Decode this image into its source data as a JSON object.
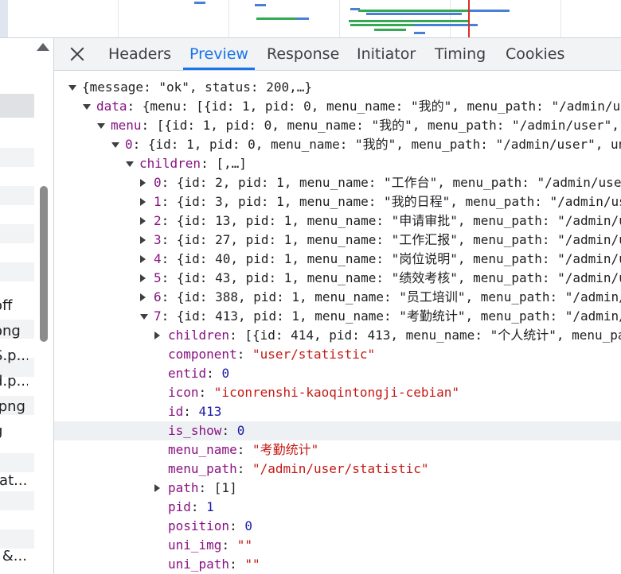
{
  "tabs": [
    {
      "label": "Headers"
    },
    {
      "label": "Preview",
      "active": true
    },
    {
      "label": "Response"
    },
    {
      "label": "Initiator"
    },
    {
      "label": "Timing"
    },
    {
      "label": "Cookies"
    }
  ],
  "left_list": {
    "items": [
      "off",
      "ong",
      "S.p...",
      "d.p...",
      ".png",
      "g",
      "tat...",
      "l &..."
    ]
  },
  "preview": {
    "lines": [
      {
        "indent": 0,
        "toggle": "down",
        "parts": [
          [
            "pl",
            "{message: \"ok\", status: 200,…}"
          ]
        ]
      },
      {
        "indent": 1,
        "toggle": "down",
        "parts": [
          [
            "key",
            "data"
          ],
          [
            "pl",
            ": {menu: [{id: 1, pid: 0, menu_name: \"我的\", menu_path: \"/admin/user\","
          ]
        ]
      },
      {
        "indent": 2,
        "toggle": "down",
        "parts": [
          [
            "key",
            "menu"
          ],
          [
            "pl",
            ": [{id: 1, pid: 0, menu_name: \"我的\", menu_path: \"/admin/user\", uni_"
          ]
        ]
      },
      {
        "indent": 3,
        "toggle": "down",
        "parts": [
          [
            "key",
            "0"
          ],
          [
            "pl",
            ": {id: 1, pid: 0, menu_name: \"我的\", menu_path: \"/admin/user\", uni_pa"
          ]
        ]
      },
      {
        "indent": 4,
        "toggle": "down",
        "parts": [
          [
            "key",
            "children"
          ],
          [
            "pl",
            ": [,…]"
          ]
        ]
      },
      {
        "indent": 5,
        "toggle": "right",
        "parts": [
          [
            "key",
            "0"
          ],
          [
            "pl",
            ": {id: 2, pid: 1, menu_name: \"工作台\", menu_path: \"/admin/user/wo"
          ]
        ]
      },
      {
        "indent": 5,
        "toggle": "right",
        "parts": [
          [
            "key",
            "1"
          ],
          [
            "pl",
            ": {id: 3, pid: 1, menu_name: \"我的日程\", menu_path: \"/admin/user/"
          ]
        ]
      },
      {
        "indent": 5,
        "toggle": "right",
        "parts": [
          [
            "key",
            "2"
          ],
          [
            "pl",
            ": {id: 13, pid: 1, menu_name: \"申请审批\", menu_path: \"/admin/user"
          ]
        ]
      },
      {
        "indent": 5,
        "toggle": "right",
        "parts": [
          [
            "key",
            "3"
          ],
          [
            "pl",
            ": {id: 27, pid: 1, menu_name: \"工作汇报\", menu_path: \"/admin/user"
          ]
        ]
      },
      {
        "indent": 5,
        "toggle": "right",
        "parts": [
          [
            "key",
            "4"
          ],
          [
            "pl",
            ": {id: 40, pid: 1, menu_name: \"岗位说明\", menu_path: \"/admin/user"
          ]
        ]
      },
      {
        "indent": 5,
        "toggle": "right",
        "parts": [
          [
            "key",
            "5"
          ],
          [
            "pl",
            ": {id: 43, pid: 1, menu_name: \"绩效考核\", menu_path: \"/admin/user"
          ]
        ]
      },
      {
        "indent": 5,
        "toggle": "right",
        "parts": [
          [
            "key",
            "6"
          ],
          [
            "pl",
            ": {id: 388, pid: 1, menu_name: \"员工培训\", menu_path: \"/admin/use"
          ]
        ]
      },
      {
        "indent": 5,
        "toggle": "down",
        "parts": [
          [
            "key",
            "7"
          ],
          [
            "pl",
            ": {id: 413, pid: 1, menu_name: \"考勤统计\", menu_path: \"/admin/use"
          ]
        ]
      },
      {
        "indent": 6,
        "toggle": "right",
        "parts": [
          [
            "key",
            "children"
          ],
          [
            "pl",
            ": [{id: 414, pid: 413, menu_name: \"个人统计\", menu_path"
          ]
        ]
      },
      {
        "indent": 6,
        "toggle": "",
        "parts": [
          [
            "key",
            "component"
          ],
          [
            "pl",
            ": "
          ],
          [
            "str",
            "\"user/statistic\""
          ]
        ]
      },
      {
        "indent": 6,
        "toggle": "",
        "parts": [
          [
            "key",
            "entid"
          ],
          [
            "pl",
            ": "
          ],
          [
            "num",
            "0"
          ]
        ]
      },
      {
        "indent": 6,
        "toggle": "",
        "parts": [
          [
            "key",
            "icon"
          ],
          [
            "pl",
            ": "
          ],
          [
            "str",
            "\"iconrenshi-kaoqintongji-cebian\""
          ]
        ]
      },
      {
        "indent": 6,
        "toggle": "",
        "parts": [
          [
            "key",
            "id"
          ],
          [
            "pl",
            ": "
          ],
          [
            "num",
            "413"
          ]
        ]
      },
      {
        "indent": 6,
        "toggle": "",
        "highlight": true,
        "parts": [
          [
            "key",
            "is_show"
          ],
          [
            "pl",
            ": "
          ],
          [
            "num",
            "0"
          ]
        ]
      },
      {
        "indent": 6,
        "toggle": "",
        "parts": [
          [
            "key",
            "menu_name"
          ],
          [
            "pl",
            ": "
          ],
          [
            "str",
            "\"考勤统计\""
          ]
        ]
      },
      {
        "indent": 6,
        "toggle": "",
        "parts": [
          [
            "key",
            "menu_path"
          ],
          [
            "pl",
            ": "
          ],
          [
            "str",
            "\"/admin/user/statistic\""
          ]
        ]
      },
      {
        "indent": 6,
        "toggle": "right",
        "parts": [
          [
            "key",
            "path"
          ],
          [
            "pl",
            ": [1]"
          ]
        ]
      },
      {
        "indent": 6,
        "toggle": "",
        "parts": [
          [
            "key",
            "pid"
          ],
          [
            "pl",
            ": "
          ],
          [
            "num",
            "1"
          ]
        ]
      },
      {
        "indent": 6,
        "toggle": "",
        "parts": [
          [
            "key",
            "position"
          ],
          [
            "pl",
            ": "
          ],
          [
            "num",
            "0"
          ]
        ]
      },
      {
        "indent": 6,
        "toggle": "",
        "parts": [
          [
            "key",
            "uni_img"
          ],
          [
            "pl",
            ": "
          ],
          [
            "str",
            "\"\""
          ]
        ]
      },
      {
        "indent": 6,
        "toggle": "",
        "parts": [
          [
            "key",
            "uni_path"
          ],
          [
            "pl",
            ": "
          ],
          [
            "str",
            "\"\""
          ]
        ]
      }
    ]
  },
  "colors": {
    "key": "#881280",
    "string": "#c41a16",
    "number": "#1a1aa6",
    "accent": "#1a73e8"
  }
}
